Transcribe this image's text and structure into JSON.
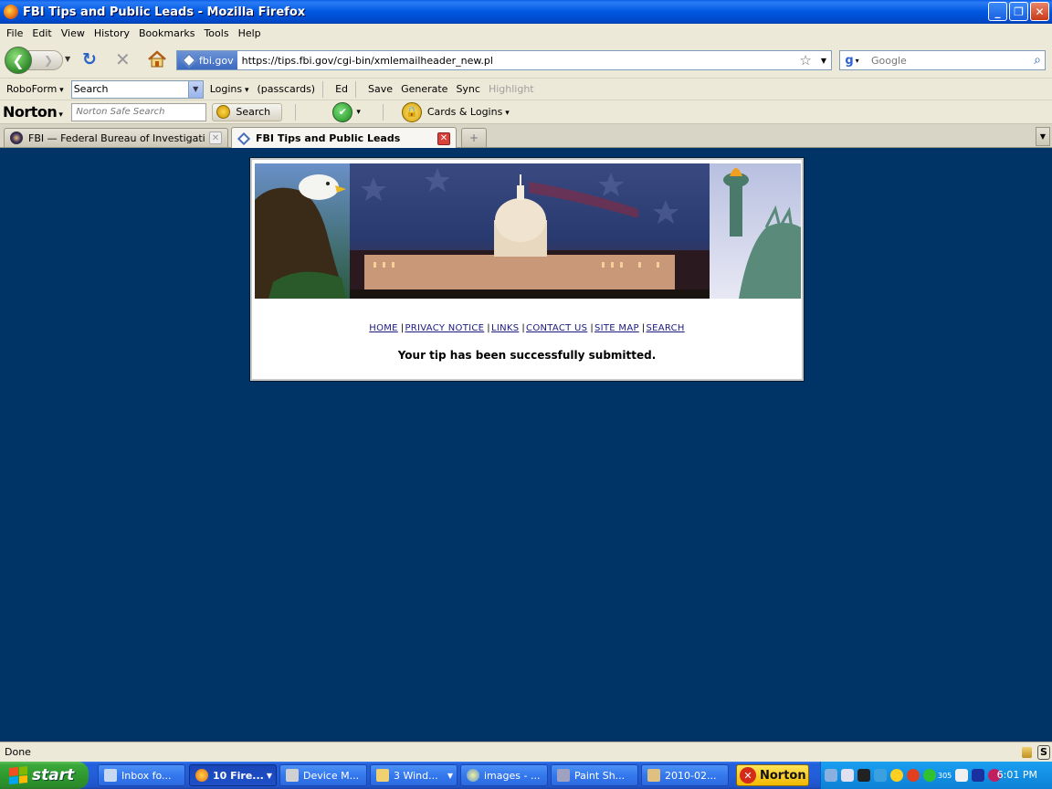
{
  "window": {
    "title": "FBI Tips and Public Leads - Mozilla Firefox",
    "minimize": "_",
    "restore": "❐",
    "close": "✕"
  },
  "menu": [
    "File",
    "Edit",
    "View",
    "History",
    "Bookmarks",
    "Tools",
    "Help"
  ],
  "nav": {
    "site_identity": "fbi.gov",
    "url": "https://tips.fbi.gov/cgi-bin/xmlemailheader_new.pl",
    "search_placeholder": "Google"
  },
  "roboform": {
    "brand": "RoboForm",
    "search_value": "Search",
    "logins": "Logins",
    "passcards": "(passcards)",
    "ed": "Ed",
    "save": "Save",
    "generate": "Generate",
    "sync": "Sync",
    "highlight": "Highlight"
  },
  "norton": {
    "brand": "Norton",
    "search_placeholder": "Norton Safe Search",
    "search_button": "Search",
    "cards_logins": "Cards & Logins"
  },
  "tabs": [
    {
      "label": "FBI — Federal Bureau of Investigation ...",
      "active": false
    },
    {
      "label": "FBI Tips and Public Leads",
      "active": true
    }
  ],
  "page": {
    "links": [
      "HOME",
      "PRIVACY NOTICE",
      "LINKS",
      "CONTACT US",
      "SITE MAP",
      "SEARCH"
    ],
    "message": "Your tip has been successfully submitted."
  },
  "status": {
    "text": "Done"
  },
  "taskbar": {
    "start": "start",
    "tasks": [
      {
        "label": "Inbox fo...",
        "pressed": false,
        "has_menu": false
      },
      {
        "label": "10 Fire...",
        "pressed": true,
        "has_menu": true
      },
      {
        "label": "Device M...",
        "pressed": false,
        "has_menu": false
      },
      {
        "label": "3 Wind...",
        "pressed": false,
        "has_menu": true
      },
      {
        "label": "images - ...",
        "pressed": false,
        "has_menu": false
      },
      {
        "label": "Paint Sh...",
        "pressed": false,
        "has_menu": false
      },
      {
        "label": "2010-02...",
        "pressed": false,
        "has_menu": false
      }
    ],
    "norton_label": "Norton",
    "tray_badge": "305",
    "clock": "6:01 PM"
  },
  "colors": {
    "page_background": "#003366",
    "link": "#1a1a80",
    "xp_blue": "#245edb",
    "start_green": "#2f9a2f"
  }
}
